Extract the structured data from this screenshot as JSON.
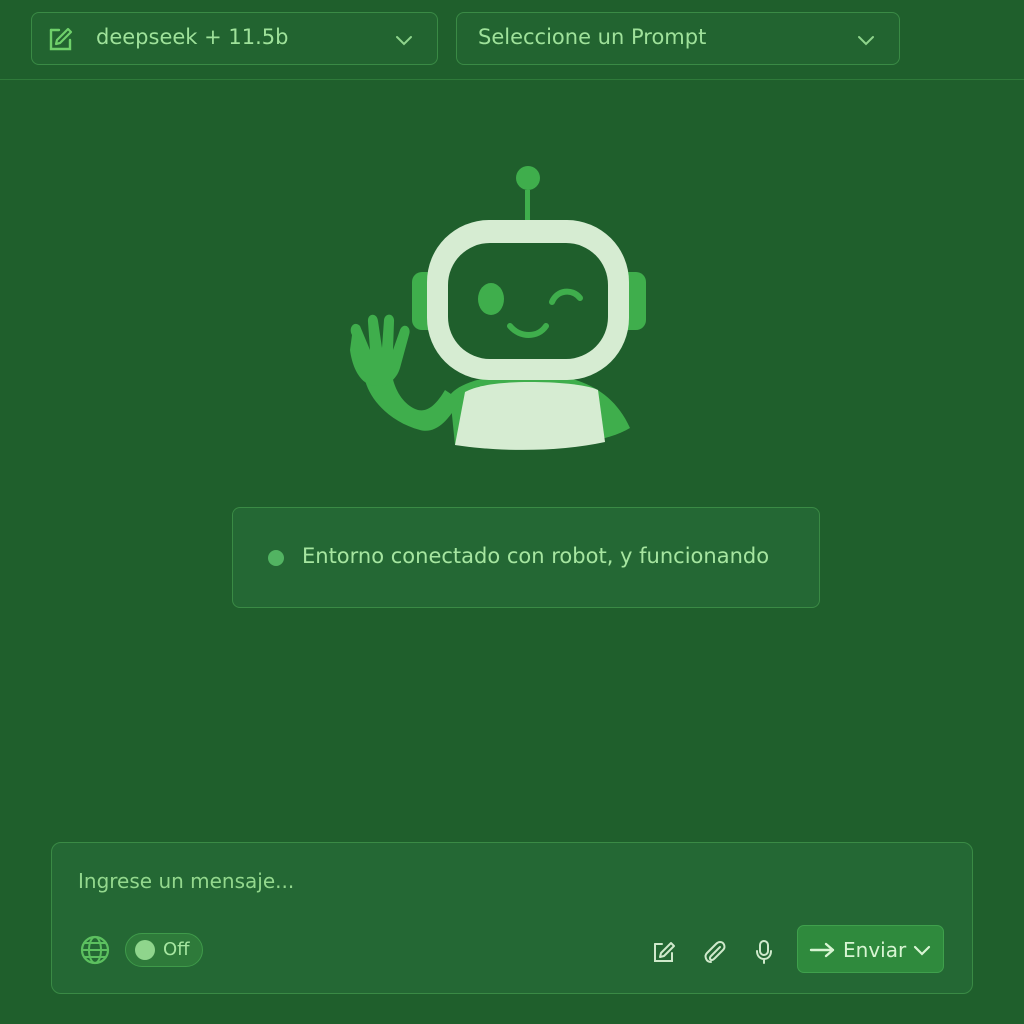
{
  "header": {
    "model_select": {
      "value": "deepseek + 11.5b",
      "icon": "edit-icon"
    },
    "prompt_select": {
      "value": "Seleccione un Prompt"
    }
  },
  "status": {
    "text": "Entorno conectado con robot, y funcionando",
    "color": "#52b462"
  },
  "composer": {
    "placeholder": "Ingrese un mensaje...",
    "web_toggle": {
      "label": "Off",
      "state": "off"
    },
    "tools": [
      "edit-icon",
      "paperclip-icon",
      "mic-icon"
    ],
    "send_label": "Enviar"
  },
  "colors": {
    "background": "#1f5f2c",
    "accent": "#3fae4c",
    "text": "#9fe29a",
    "robot_face": "#d6ecd2"
  }
}
